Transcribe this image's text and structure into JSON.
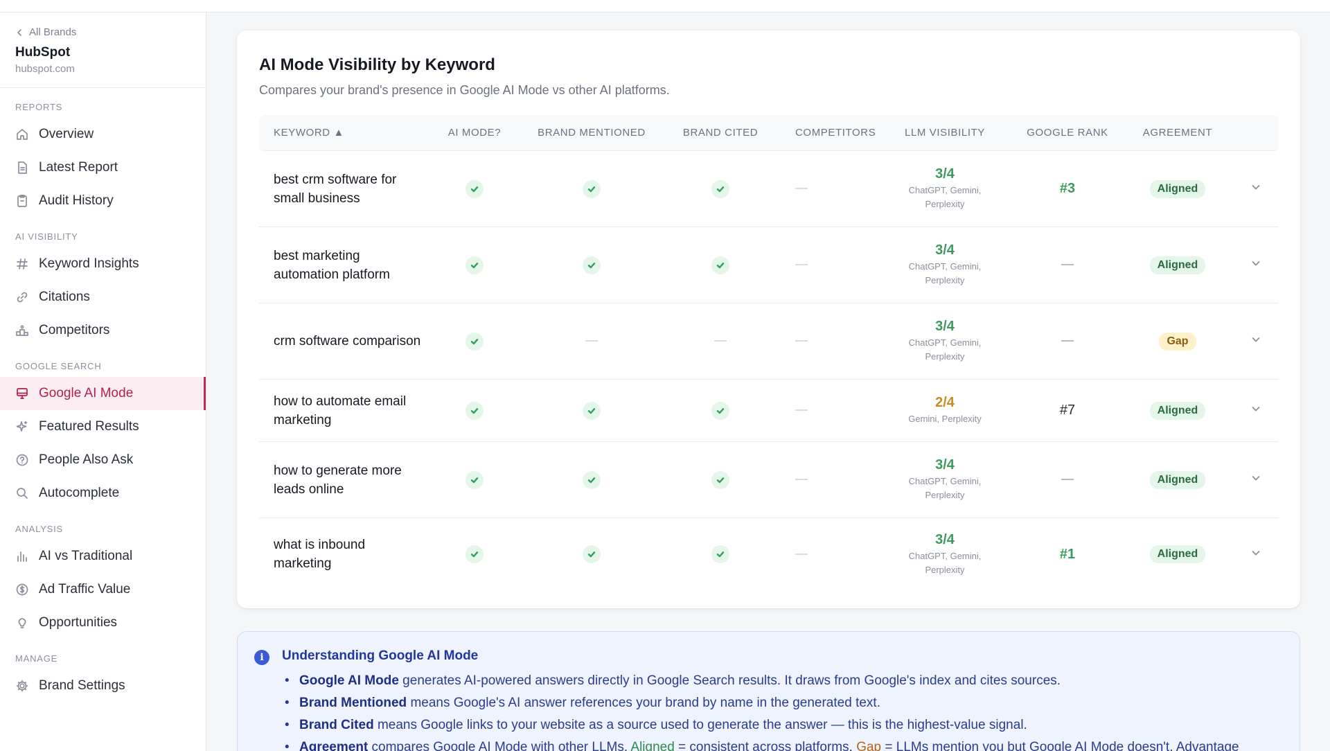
{
  "sidebar": {
    "back_label": "All Brands",
    "brand_name": "HubSpot",
    "brand_domain": "hubspot.com",
    "sections": [
      {
        "label": "REPORTS",
        "items": [
          "Overview",
          "Latest Report",
          "Audit History"
        ]
      },
      {
        "label": "AI VISIBILITY",
        "items": [
          "Keyword Insights",
          "Citations",
          "Competitors"
        ]
      },
      {
        "label": "GOOGLE SEARCH",
        "items": [
          "Google AI Mode",
          "Featured Results",
          "People Also Ask",
          "Autocomplete"
        ]
      },
      {
        "label": "ANALYSIS",
        "items": [
          "AI vs Traditional",
          "Ad Traffic Value",
          "Opportunities"
        ]
      },
      {
        "label": "MANAGE",
        "items": [
          "Brand Settings"
        ]
      }
    ],
    "active_item": "Google AI Mode"
  },
  "card": {
    "title": "AI Mode Visibility by Keyword",
    "subtitle": "Compares your brand's presence in Google AI Mode vs other AI platforms."
  },
  "table": {
    "columns": [
      "KEYWORD ▲",
      "AI MODE?",
      "BRAND MENTIONED",
      "BRAND CITED",
      "COMPETITORS",
      "LLM VISIBILITY",
      "GOOGLE RANK",
      "AGREEMENT"
    ],
    "rows": [
      {
        "keyword": "best crm software for small business",
        "ai_mode": true,
        "mentioned": true,
        "cited": true,
        "competitors": "—",
        "llm_score": "3/4",
        "llm_models": "ChatGPT, Gemini, Perplexity",
        "google_rank": "#3",
        "agreement": "Aligned"
      },
      {
        "keyword": "best marketing automation platform",
        "ai_mode": true,
        "mentioned": true,
        "cited": true,
        "competitors": "—",
        "llm_score": "3/4",
        "llm_models": "ChatGPT, Gemini, Perplexity",
        "google_rank": "—",
        "agreement": "Aligned"
      },
      {
        "keyword": "crm software comparison",
        "ai_mode": true,
        "mentioned": false,
        "cited": false,
        "competitors": "—",
        "llm_score": "3/4",
        "llm_models": "ChatGPT, Gemini, Perplexity",
        "google_rank": "—",
        "agreement": "Gap"
      },
      {
        "keyword": "how to automate email marketing",
        "ai_mode": true,
        "mentioned": true,
        "cited": true,
        "competitors": "—",
        "llm_score": "2/4",
        "llm_models": "Gemini, Perplexity",
        "google_rank": "#7",
        "agreement": "Aligned"
      },
      {
        "keyword": "how to generate more leads online",
        "ai_mode": true,
        "mentioned": true,
        "cited": true,
        "competitors": "—",
        "llm_score": "3/4",
        "llm_models": "ChatGPT, Gemini, Perplexity",
        "google_rank": "—",
        "agreement": "Aligned"
      },
      {
        "keyword": "what is inbound marketing",
        "ai_mode": true,
        "mentioned": true,
        "cited": true,
        "competitors": "—",
        "llm_score": "3/4",
        "llm_models": "ChatGPT, Gemini, Perplexity",
        "google_rank": "#1",
        "agreement": "Aligned"
      }
    ]
  },
  "info": {
    "title": "Understanding Google AI Mode",
    "items": [
      {
        "term": "Google AI Mode",
        "text": " generates AI-powered answers directly in Google Search results. It draws from Google's index and cites sources."
      },
      {
        "term": "Brand Mentioned",
        "text": " means Google's AI answer references your brand by name in the generated text."
      },
      {
        "term": "Brand Cited",
        "text": " means Google links to your website as a source used to generate the answer — this is the highest-value signal."
      },
      {
        "term": "Agreement",
        "text": " compares Google AI Mode with other LLMs. ",
        "aligned": "Aligned",
        "aligned_text": " = consistent across platforms. ",
        "gap": "Gap",
        "gap_text": " = LLMs mention you but Google AI Mode doesn't. ",
        "advantage": "Advantage"
      }
    ]
  },
  "colors": {
    "accent": "#c2285a",
    "success": "#3d9a5c",
    "warning": "#c98a24",
    "info": "#3b5bd6"
  }
}
